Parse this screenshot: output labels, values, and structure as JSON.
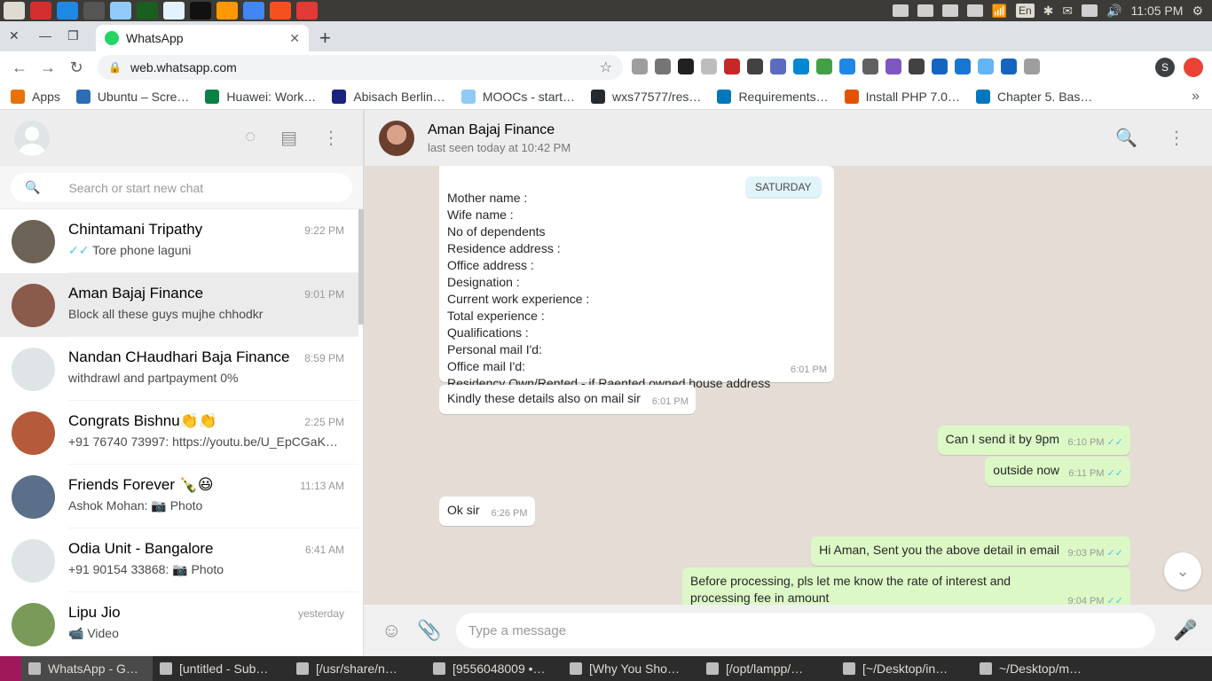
{
  "system": {
    "clock": "11:05 PM",
    "lang": "En",
    "launcher_colors": [
      "#dfdbd2",
      "#d32f2f",
      "#1e88e5",
      "#555555",
      "#90caf9",
      "#1b5e20",
      "#e3f2fd",
      "#111111",
      "#ff9800",
      "#4285f4",
      "#f4511e",
      "#e53935"
    ]
  },
  "browser": {
    "tab_title": "WhatsApp",
    "url": "web.whatsapp.com",
    "profile_initial": "S",
    "bookmarks": [
      {
        "label": "Apps",
        "color": "#e8710a"
      },
      {
        "label": "Ubuntu – Scre…",
        "color": "#2d6db5"
      },
      {
        "label": "Huawei: Work…",
        "color": "#0a8043"
      },
      {
        "label": "Abisach Berlin…",
        "color": "#1a237e"
      },
      {
        "label": "MOOCs - start…",
        "color": "#90caf9"
      },
      {
        "label": "wxs77577/res…",
        "color": "#24292e"
      },
      {
        "label": "Requirements…",
        "color": "#0277bd"
      },
      {
        "label": "Install PHP 7.0…",
        "color": "#e65100"
      },
      {
        "label": "Chapter 5. Bas…",
        "color": "#0277bd"
      }
    ],
    "extension_colors": [
      "#9e9e9e",
      "#757575",
      "#212121",
      "#bdbdbd",
      "#c62828",
      "#424242",
      "#5c6bc0",
      "#0288d1",
      "#43a047",
      "#1e88e5",
      "#616161",
      "#7e57c2",
      "#424242",
      "#1565c0",
      "#1976d2",
      "#64b5f6",
      "#1565c0",
      "#9e9e9e"
    ]
  },
  "sidebar": {
    "search_placeholder": "Search or start new chat",
    "chats": [
      {
        "name": "Chintamani Tripathy",
        "time": "9:22 PM",
        "last": "Tore phone laguni",
        "ticks": "✓✓",
        "avatar": "#6d6256",
        "active": false
      },
      {
        "name": "Aman Bajaj Finance",
        "time": "9:01 PM",
        "last": "Block all these guys mujhe chhodkr",
        "ticks": "",
        "avatar": "#8a5a4a",
        "active": true
      },
      {
        "name": "Nandan CHaudhari Baja Finance",
        "time": "8:59 PM",
        "last": "withdrawl and partpayment 0%",
        "ticks": "",
        "avatar": "#dfe5e7",
        "active": false
      },
      {
        "name": "Congrats Bishnu👏👏",
        "time": "2:25 PM",
        "last": "+91 76740 73997: https://youtu.be/U_EpCGaK…",
        "ticks": "",
        "avatar": "#b55a3a",
        "active": false
      },
      {
        "name": "Friends Forever 🍾😃",
        "time": "11:13 AM",
        "last": "Ashok Mohan: 📷 Photo",
        "ticks": "",
        "avatar": "#5b6e8a",
        "active": false
      },
      {
        "name": "Odia Unit - Bangalore",
        "time": "6:41 AM",
        "last": "+91 90154 33868: 📷 Photo",
        "ticks": "",
        "avatar": "#dfe5e7",
        "active": false
      },
      {
        "name": "Lipu Jio",
        "time": "yesterday",
        "last": "📹 Video",
        "ticks": "",
        "avatar": "#7a9a5a",
        "active": false
      }
    ]
  },
  "conversation": {
    "contact_name": "Aman Bajaj Finance",
    "status": "last seen today at 10:42 PM",
    "day_label": "SATURDAY",
    "form_lines": "Mother name :\nWife name :\nNo of dependents\nResidence  address :\nOffice address  :\nDesignation :\nCurrent work experience :\nTotal experience :\nQualifications :\nPersonal mail I'd:\nOffice mail I'd:\nResidency Own/Rented  - if Raented owned house address",
    "form_time": "6:01 PM",
    "messages": [
      {
        "text": "Kindly these details also on mail sir",
        "time": "6:01 PM",
        "dir": "in"
      },
      {
        "text": "Can I send it by 9pm",
        "time": "6:10 PM",
        "dir": "out"
      },
      {
        "text": "outside now",
        "time": "6:11 PM",
        "dir": "out"
      },
      {
        "text": "Ok sir",
        "time": "6:26 PM",
        "dir": "in"
      },
      {
        "text": "Hi Aman, Sent you the above detail in email",
        "time": "9:03 PM",
        "dir": "out"
      },
      {
        "text": "Before processing, pls let me know the rate of interest and processing fee in amount",
        "time": "9:04 PM",
        "dir": "out"
      }
    ],
    "composer_placeholder": "Type a message"
  },
  "taskbar": {
    "items": [
      "WhatsApp - G…",
      "[untitled - Sub…",
      "[/usr/share/n…",
      "[9556048009 •…",
      "[Why You Sho…",
      "[/opt/lampp/…",
      "[~/Desktop/in…",
      "~/Desktop/m…"
    ]
  }
}
